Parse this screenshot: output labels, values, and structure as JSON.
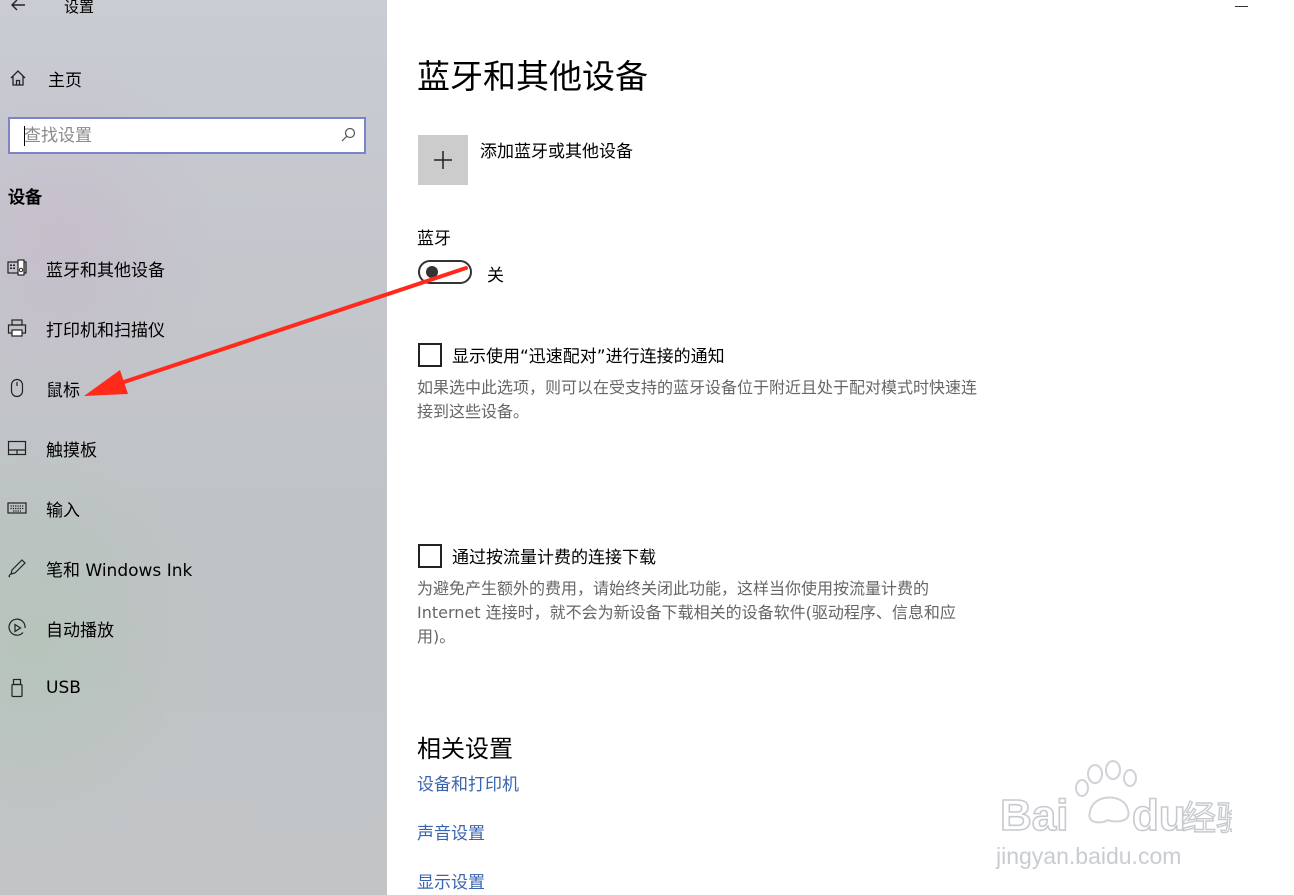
{
  "window": {
    "title": "设置"
  },
  "sidebar": {
    "home_label": "主页",
    "search_placeholder": "查找设置",
    "section_title": "设备",
    "items": [
      {
        "label": "蓝牙和其他设备",
        "icon": "bluetooth-devices-icon"
      },
      {
        "label": "打印机和扫描仪",
        "icon": "printer-icon"
      },
      {
        "label": "鼠标",
        "icon": "mouse-icon"
      },
      {
        "label": "触摸板",
        "icon": "touchpad-icon"
      },
      {
        "label": "输入",
        "icon": "keyboard-icon"
      },
      {
        "label": "笔和 Windows Ink",
        "icon": "pen-icon"
      },
      {
        "label": "自动播放",
        "icon": "autoplay-icon"
      },
      {
        "label": "USB",
        "icon": "usb-icon"
      }
    ]
  },
  "main": {
    "title": "蓝牙和其他设备",
    "add_device_label": "添加蓝牙或其他设备",
    "bluetooth_label": "蓝牙",
    "bluetooth_state": "关",
    "swift_pair": {
      "label": "显示使用“迅速配对”进行连接的通知",
      "checked": false,
      "description": "如果选中此选项，则可以在受支持的蓝牙设备位于附近且处于配对模式时快速连接到这些设备。"
    },
    "metered": {
      "label": "通过按流量计费的连接下载",
      "checked": false,
      "description": "为避免产生额外的费用，请始终关闭此功能，这样当你使用按流量计费的 Internet 连接时，就不会为新设备下载相关的设备软件(驱动程序、信息和应用)。"
    },
    "related_title": "相关设置",
    "related_links": [
      "设备和打印机",
      "声音设置",
      "显示设置"
    ]
  },
  "watermark": {
    "brand_left": "Bai",
    "brand_right": "du",
    "cn": "经验",
    "url": "jingyan.baidu.com"
  },
  "colors": {
    "link": "#3a64b0",
    "search_border": "#7b84c8",
    "annotation_arrow": "#ff2a1a"
  }
}
